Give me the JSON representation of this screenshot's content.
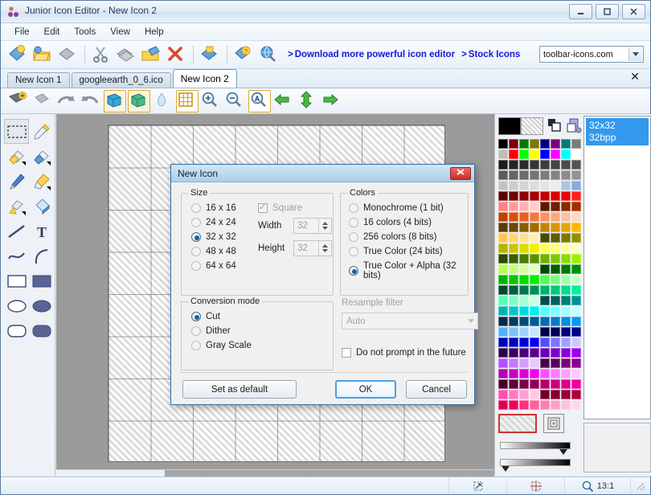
{
  "window": {
    "title": "Junior Icon Editor - New Icon 2",
    "icon": "app-icon",
    "minimize": "–",
    "maximize": "▫",
    "close": "✕"
  },
  "menu": {
    "items": [
      {
        "label": "File"
      },
      {
        "label": "Edit"
      },
      {
        "label": "Tools"
      },
      {
        "label": "View"
      },
      {
        "label": "Help"
      }
    ]
  },
  "toolbar_main": {
    "buttons": [
      {
        "name": "new-icon-button",
        "icon": "new-document-icon"
      },
      {
        "name": "open-button",
        "icon": "open-folder-icon"
      },
      {
        "name": "save-button",
        "icon": "save-icon"
      },
      {
        "name": "cut-button",
        "icon": "scissors-icon"
      },
      {
        "name": "copy-button",
        "icon": "copy-icon"
      },
      {
        "name": "paste-button",
        "icon": "paste-icon"
      },
      {
        "name": "delete-button",
        "icon": "delete-x-icon"
      },
      {
        "name": "import-button",
        "icon": "import-icon"
      },
      {
        "name": "properties-button",
        "icon": "properties-icon"
      },
      {
        "name": "preview-button",
        "icon": "search-globe-icon"
      }
    ],
    "link_download": "Download more powerful icon editor",
    "link_stock": "Stock Icons",
    "chevron": ">",
    "site_combo_value": "toolbar-icons.com"
  },
  "tabs": {
    "items": [
      {
        "label": "New Icon 1",
        "active": false
      },
      {
        "label": "googleearth_0_6.ico",
        "active": false
      },
      {
        "label": "New Icon 2",
        "active": true
      }
    ],
    "close_label": "✕"
  },
  "toolbar_edit": {
    "buttons": [
      {
        "name": "add-image-button",
        "icon": "add-image-icon"
      },
      {
        "name": "remove-image-button",
        "icon": "remove-image-icon"
      },
      {
        "name": "undo-button",
        "icon": "undo-arrow-icon"
      },
      {
        "name": "redo-button",
        "icon": "redo-arrow-icon"
      },
      {
        "name": "depth-blue-button",
        "icon": "cube-blue-icon"
      },
      {
        "name": "depth-green-button",
        "icon": "cube-green-icon"
      },
      {
        "name": "smooth-button",
        "icon": "water-drop-icon"
      },
      {
        "name": "grid-button",
        "icon": "grid-icon"
      },
      {
        "name": "zoom-in-button",
        "icon": "zoom-in-icon"
      },
      {
        "name": "zoom-out-button",
        "icon": "zoom-out-icon"
      },
      {
        "name": "zoom-text-button",
        "icon": "zoom-text-icon"
      },
      {
        "name": "move-left-button",
        "icon": "arrow-left-green-icon"
      },
      {
        "name": "move-vertical-button",
        "icon": "arrow-updown-green-icon"
      },
      {
        "name": "move-right-button",
        "icon": "arrow-right-green-icon"
      }
    ]
  },
  "tools": {
    "items": [
      {
        "name": "tool-select-rectangle",
        "icon": "marquee-icon",
        "active": true
      },
      {
        "name": "tool-color-picker",
        "icon": "eyedropper-icon",
        "active": false
      },
      {
        "name": "tool-eraser",
        "icon": "eraser-yellow-icon",
        "active": false
      },
      {
        "name": "tool-eraser-blue",
        "icon": "eraser-blue-icon",
        "active": false
      },
      {
        "name": "tool-pencil",
        "icon": "pencil-icon",
        "active": false
      },
      {
        "name": "tool-marker",
        "icon": "marker-icon",
        "active": false
      },
      {
        "name": "tool-airbrush",
        "icon": "airbrush-icon",
        "active": false
      },
      {
        "name": "tool-paint-bucket",
        "icon": "paint-bucket-icon",
        "active": false
      },
      {
        "name": "tool-line",
        "icon": "line-icon",
        "active": false
      },
      {
        "name": "tool-text",
        "icon": "text-t-icon",
        "active": false
      },
      {
        "name": "tool-curve",
        "icon": "curve-s-icon",
        "active": false
      },
      {
        "name": "tool-arc",
        "icon": "arc-icon",
        "active": false
      },
      {
        "name": "tool-rectangle",
        "icon": "rectangle-outline-icon",
        "active": false
      },
      {
        "name": "tool-rectangle-filled",
        "icon": "rectangle-filled-icon",
        "active": false
      },
      {
        "name": "tool-ellipse",
        "icon": "ellipse-outline-icon",
        "active": false
      },
      {
        "name": "tool-ellipse-filled",
        "icon": "ellipse-filled-icon",
        "active": false
      },
      {
        "name": "tool-rounded-rect",
        "icon": "rounded-rect-outline-icon",
        "active": false
      },
      {
        "name": "tool-rounded-rect-filled",
        "icon": "rounded-rect-filled-icon",
        "active": false
      }
    ]
  },
  "palette": {
    "primary_color": "#000000",
    "secondary_color": "transparent",
    "swatches": [
      "#000000",
      "#7b0000",
      "#007b00",
      "#7b7b00",
      "#00007b",
      "#7b007b",
      "#007b7b",
      "#7b7b7b",
      "#bdbdbd",
      "#ff0000",
      "#00ff00",
      "#ffff00",
      "#0000ff",
      "#ff00ff",
      "#00ffff",
      "#ffffff",
      "#1c1c1c",
      "#242424",
      "#2c2c2c",
      "#343434",
      "#3c3c3c",
      "#444444",
      "#4c4c4c",
      "#545454",
      "#5c5c5c",
      "#646464",
      "#6c6c6c",
      "#747474",
      "#7c7c7c",
      "#848484",
      "#8c8c8c",
      "#949494",
      "#c4c4c4",
      "#cccccc",
      "#d4d4d4",
      "#dcdcdc",
      "#e4e4e4",
      "#ececec",
      "#b0c4de",
      "#88aadd",
      "#5a0000",
      "#730000",
      "#8b0000",
      "#a80000",
      "#c40000",
      "#dd0000",
      "#f00000",
      "#ff2020",
      "#ff8080",
      "#ff9a9a",
      "#ffb3b3",
      "#ffcccc",
      "#5a1800",
      "#6e2000",
      "#8a2800",
      "#a03000",
      "#c44000",
      "#d85010",
      "#e86020",
      "#f47840",
      "#ff9060",
      "#ffa880",
      "#ffc0a0",
      "#ffd8c0",
      "#5a3c00",
      "#6e4a00",
      "#8a5c00",
      "#a06c00",
      "#c48400",
      "#d89400",
      "#e8a400",
      "#ffb400",
      "#ffc84c",
      "#ffd470",
      "#ffe094",
      "#ffecb8",
      "#4a4a00",
      "#5e5e00",
      "#7a7a00",
      "#909000",
      "#b4b400",
      "#c8c800",
      "#dcdc00",
      "#f0f000",
      "#ffff50",
      "#ffff78",
      "#ffffa0",
      "#ffffc8",
      "#2c4a00",
      "#3a5e00",
      "#4a7a00",
      "#5a9000",
      "#6cb400",
      "#7cc800",
      "#8cdc00",
      "#9cf000",
      "#b4ff50",
      "#c4ff78",
      "#d4ffa0",
      "#e4ffc8",
      "#004a00",
      "#005e00",
      "#007a00",
      "#009000",
      "#00b400",
      "#00c800",
      "#00dc00",
      "#00f000",
      "#50ff50",
      "#78ff78",
      "#a0ffa0",
      "#c8ffc8",
      "#004a2c",
      "#005e3a",
      "#007a4a",
      "#00905a",
      "#00b46c",
      "#00c87c",
      "#00dc8c",
      "#00f09c",
      "#50ffb4",
      "#78ffc4",
      "#a0ffd4",
      "#c8ffe4",
      "#004a4a",
      "#005e5e",
      "#007a7a",
      "#009090",
      "#00b4b4",
      "#00c8c8",
      "#00dcdc",
      "#00f0f0",
      "#50ffff",
      "#78ffff",
      "#a0ffff",
      "#c8ffff",
      "#002c4a",
      "#003a5e",
      "#004a7a",
      "#005a90",
      "#006cb4",
      "#007cc8",
      "#008cdc",
      "#009cf0",
      "#50b4ff",
      "#78c4ff",
      "#a0d4ff",
      "#c8e4ff",
      "#00004a",
      "#00005e",
      "#00007a",
      "#000090",
      "#0000b4",
      "#0000c8",
      "#0000dc",
      "#0000f0",
      "#5050ff",
      "#7878ff",
      "#a0a0ff",
      "#c8c8ff",
      "#2c004a",
      "#3a005e",
      "#4a007a",
      "#5a0090",
      "#6c00b4",
      "#7c00c8",
      "#8c00dc",
      "#9c00f0",
      "#b450ff",
      "#c478ff",
      "#d4a0ff",
      "#e4c8ff",
      "#4a004a",
      "#5e005e",
      "#7a007a",
      "#900090",
      "#b400b4",
      "#c800c8",
      "#dc00dc",
      "#f000f0",
      "#ff50ff",
      "#ff78ff",
      "#ffa0ff",
      "#ffc8ff",
      "#4a002c",
      "#5e003a",
      "#7a004a",
      "#90005a",
      "#b4006c",
      "#c8007c",
      "#dc008c",
      "#f0009c",
      "#ff50b4",
      "#ff78c4",
      "#ffa0d4",
      "#ffc8e4",
      "#6e0028",
      "#82002e",
      "#960036",
      "#aa003e",
      "#e00050",
      "#f00060",
      "#ff3080",
      "#ff6098",
      "#ff80b0",
      "#ffa0c4",
      "#ffc0d8",
      "#ffd8e8"
    ],
    "transparent_label": "transparent-swatch"
  },
  "image_list": {
    "items": [
      {
        "size": "32x32",
        "depth": "32bpp",
        "selected": true
      }
    ]
  },
  "statusbar": {
    "zoom_label": "13:1",
    "cells": [
      {
        "name": "status-image-info",
        "icon": "image-size-icon"
      },
      {
        "name": "status-cursor-pos",
        "icon": "crosshair-icon"
      },
      {
        "name": "status-zoom",
        "icon": "magnifier-icon"
      }
    ]
  },
  "dialog": {
    "title": "New Icon",
    "close_label": "✕",
    "size_group": {
      "label": "Size",
      "options": [
        {
          "label": "16 x 16",
          "selected": false
        },
        {
          "label": "24 x 24",
          "selected": false
        },
        {
          "label": "32 x 32",
          "selected": true
        },
        {
          "label": "48 x 48",
          "selected": false
        },
        {
          "label": "64 x 64",
          "selected": false
        }
      ],
      "square_label": "Square",
      "square_checked": true,
      "width_label": "Width",
      "width_value": "32",
      "height_label": "Height",
      "height_value": "32"
    },
    "colors_group": {
      "label": "Colors",
      "options": [
        {
          "label": "Monochrome (1 bit)",
          "selected": false
        },
        {
          "label": "16 colors (4 bits)",
          "selected": false
        },
        {
          "label": "256 colors (8 bits)",
          "selected": false
        },
        {
          "label": "True Color (24 bits)",
          "selected": false
        },
        {
          "label": "True Color + Alpha (32 bits)",
          "selected": true
        }
      ]
    },
    "conversion_group": {
      "label": "Conversion mode",
      "options": [
        {
          "label": "Cut",
          "selected": true
        },
        {
          "label": "Dither",
          "selected": false
        },
        {
          "label": "Gray Scale",
          "selected": false
        }
      ]
    },
    "resample": {
      "label": "Resample filter",
      "value": "Auto"
    },
    "do_not_prompt_label": "Do not prompt in the future",
    "do_not_prompt_checked": false,
    "buttons": {
      "set_default": "Set as default",
      "ok": "OK",
      "cancel": "Cancel"
    }
  }
}
